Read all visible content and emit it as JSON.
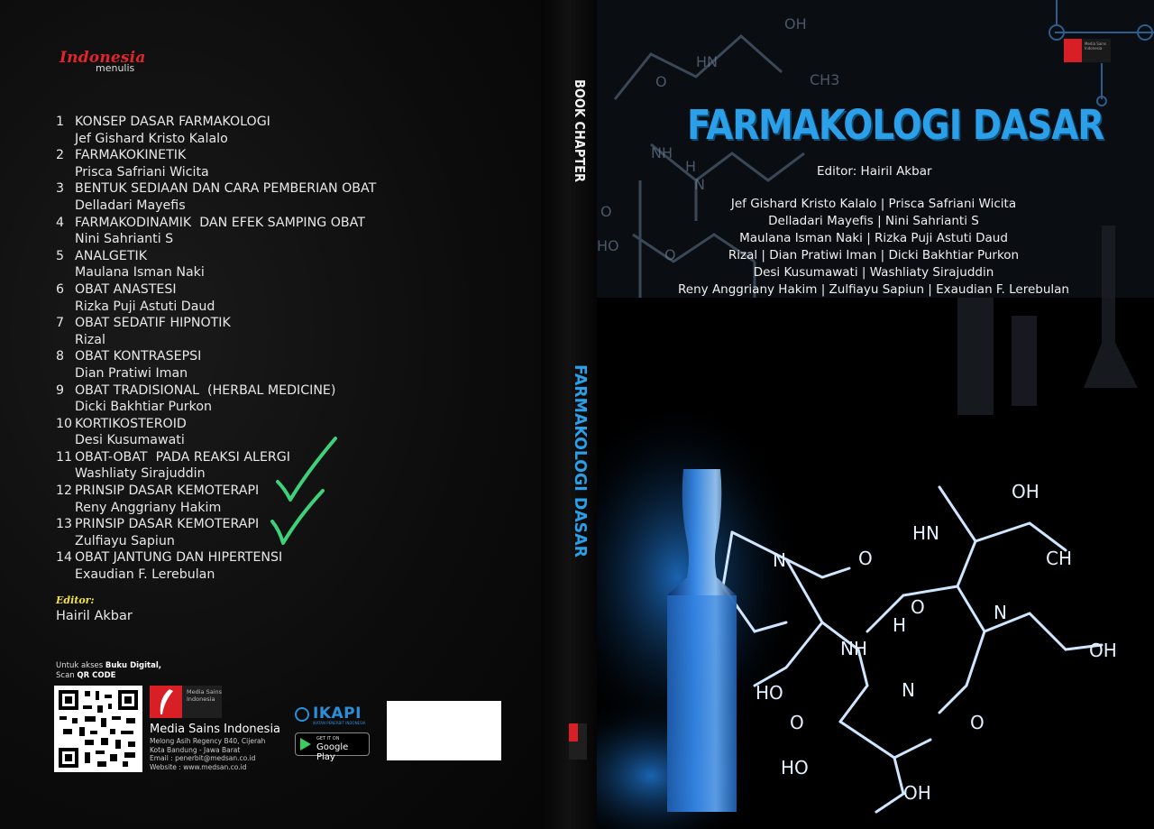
{
  "back_cover": {
    "logo": {
      "brand": "Indonesia",
      "sub": "menulis"
    },
    "toc": [
      {
        "num": "1",
        "title": "KONSEP DASAR FARMAKOLOGI",
        "author": "Jef Gishard Kristo Kalalo"
      },
      {
        "num": "2",
        "title": "FARMAKOKINETIK",
        "author": "Prisca Safriani Wicita"
      },
      {
        "num": "3",
        "title": "BENTUK SEDIAAN DAN CARA PEMBERIAN OBAT",
        "author": "Delladari Mayefis"
      },
      {
        "num": "4",
        "title": "FARMAKODINAMIK  DAN EFEK SAMPING OBAT",
        "author": "Nini Sahrianti S"
      },
      {
        "num": "5",
        "title": "ANALGETIK",
        "author": "Maulana Isman Naki"
      },
      {
        "num": "6",
        "title": "OBAT ANASTESI",
        "author": "Rizka Puji Astuti Daud"
      },
      {
        "num": "7",
        "title": "OBAT SEDATIF HIPNOTIK",
        "author": "Rizal"
      },
      {
        "num": "8",
        "title": "OBAT KONTRASEPSI",
        "author": "Dian Pratiwi Iman"
      },
      {
        "num": "9",
        "title": "OBAT TRADISIONAL  (HERBAL MEDICINE)",
        "author": "Dicki Bakhtiar Purkon"
      },
      {
        "num": "10",
        "title": "KORTIKOSTEROID",
        "author": "Desi Kusumawati"
      },
      {
        "num": "11",
        "title": "OBAT-OBAT  PADA REAKSI ALERGI",
        "author": "Washliaty Sirajuddin"
      },
      {
        "num": "12",
        "title": "PRINSIP DASAR KEMOTERAPI",
        "author": "Reny Anggriany Hakim"
      },
      {
        "num": "13",
        "title": "PRINSIP DASAR KEMOTERAPI",
        "author": "Zulfiayu Sapiun"
      },
      {
        "num": "14",
        "title": "OBAT JANTUNG DAN HIPERTENSI",
        "author": "Exaudian F. Lerebulan"
      }
    ],
    "editor_label": "Editor:",
    "editor_name": "Hairil Akbar",
    "access_text_1": "Untuk akses",
    "access_bold": "Buku Digital,",
    "access_text_2": "Scan",
    "access_bold_2": "QR CODE",
    "publisher_logo_text": "Media Sains Indonesia",
    "publisher": {
      "name": "Media Sains Indonesia",
      "address_1": "Melong Asih Regency B40, Cijerah",
      "address_2": "Kota Bandung - Jawa Barat",
      "email": "Email : penerbit@medsan.co.id",
      "website": "Website : www.medsan.co.id"
    },
    "ikapi": {
      "word": "IKAPI",
      "tag": "IKATAN PENERBIT INDONESIA"
    },
    "google_play": {
      "small": "GET IT ON",
      "big": "Google Play"
    },
    "colors": {
      "check": "#3ed07a",
      "logo_red": "#e0262b"
    }
  },
  "spine": {
    "label": "BOOK CHAPTER",
    "title": "FARMAKOLOGI DASAR"
  },
  "front_cover": {
    "title": "FARMAKOLOGI DASAR",
    "editor": "Editor: Hairil Akbar",
    "authors": [
      "Jef Gishard Kristo Kalalo | Prisca Safriani Wicita",
      "Delladari Mayefis | Nini Sahrianti S",
      "Maulana Isman Naki | Rizka Puji Astuti Daud",
      "Rizal | Dian Pratiwi Iman | Dicki Bakhtiar Purkon",
      "Desi Kusumawati | Washliaty Sirajuddin",
      "Reny Anggriany Hakim | Zulfiayu Sapiun  |  Exaudian F. Lerebulan"
    ],
    "colors": {
      "title": "#2b9fe8",
      "molecule": "#cfe6ff"
    }
  }
}
